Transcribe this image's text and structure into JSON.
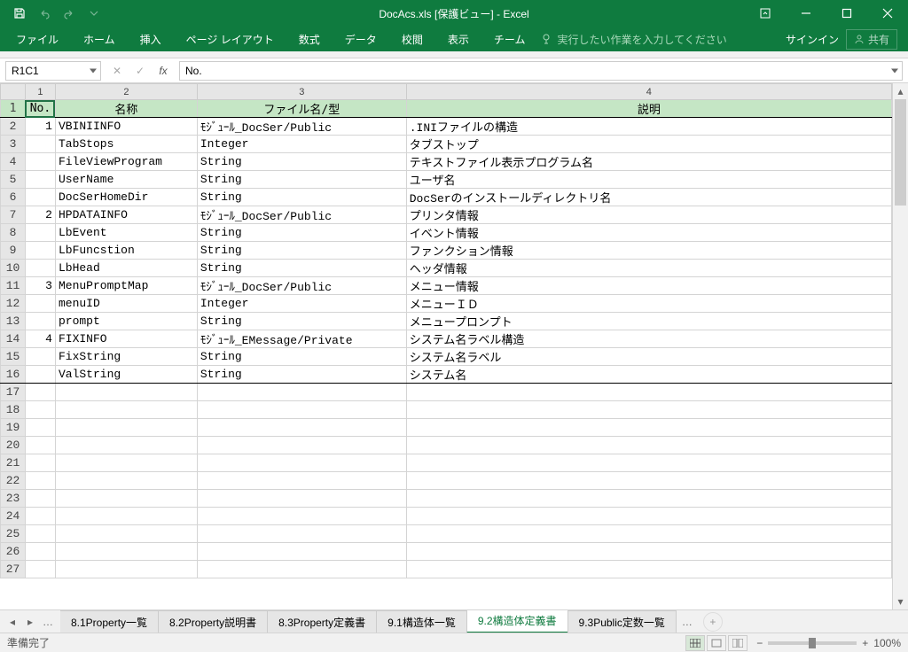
{
  "title": "DocAcs.xls  [保護ビュー] - Excel",
  "signin_label": "サインイン",
  "share_label": "共有",
  "ribbon_tabs": [
    "ファイル",
    "ホーム",
    "挿入",
    "ページ レイアウト",
    "数式",
    "データ",
    "校閲",
    "表示",
    "チーム"
  ],
  "tellme": "実行したい作業を入力してください",
  "namebox": "R1C1",
  "formula": "No.",
  "col_numbers": [
    "1",
    "2",
    "3",
    "4"
  ],
  "headers": {
    "c1": "No.",
    "c2": "名称",
    "c3": "ファイル名/型",
    "c4": "説明"
  },
  "rows": [
    {
      "no": "1",
      "name": "VBINIINFO",
      "type": "ﾓｼﾞｭｰﾙ_DocSer/Public",
      "desc": ".INIファイルの構造"
    },
    {
      "no": "",
      "name": "TabStops",
      "type": "Integer",
      "desc": "タブストップ"
    },
    {
      "no": "",
      "name": "FileViewProgram",
      "type": "String",
      "desc": "テキストファイル表示プログラム名"
    },
    {
      "no": "",
      "name": "UserName",
      "type": "String",
      "desc": "ユーザ名"
    },
    {
      "no": "",
      "name": "DocSerHomeDir",
      "type": "String",
      "desc": "DocSerのインストールディレクトリ名"
    },
    {
      "no": "2",
      "name": "HPDATAINFO",
      "type": "ﾓｼﾞｭｰﾙ_DocSer/Public",
      "desc": "プリンタ情報"
    },
    {
      "no": "",
      "name": "LbEvent",
      "type": "String",
      "desc": "イベント情報"
    },
    {
      "no": "",
      "name": "LbFuncstion",
      "type": "String",
      "desc": "ファンクション情報"
    },
    {
      "no": "",
      "name": "LbHead",
      "type": "String",
      "desc": "ヘッダ情報"
    },
    {
      "no": "3",
      "name": "MenuPromptMap",
      "type": "ﾓｼﾞｭｰﾙ_DocSer/Public",
      "desc": "メニュー情報"
    },
    {
      "no": "",
      "name": "menuID",
      "type": "Integer",
      "desc": "メニューＩＤ"
    },
    {
      "no": "",
      "name": "prompt",
      "type": "String",
      "desc": "メニュープロンプト"
    },
    {
      "no": "4",
      "name": "FIXINFO",
      "type": "ﾓｼﾞｭｰﾙ_EMessage/Private",
      "desc": "システム名ラベル構造"
    },
    {
      "no": "",
      "name": "FixString",
      "type": "String",
      "desc": "システム名ラベル"
    },
    {
      "no": "",
      "name": "ValString",
      "type": "String",
      "desc": "システム名"
    }
  ],
  "empty_rows": 11,
  "sheet_tabs": [
    "8.1Property一覧",
    "8.2Property説明書",
    "8.3Property定義書",
    "9.1構造体一覧",
    "9.2構造体定義書",
    "9.3Public定数一覧"
  ],
  "active_tab_index": 4,
  "status": "準備完了",
  "zoom": "100%"
}
